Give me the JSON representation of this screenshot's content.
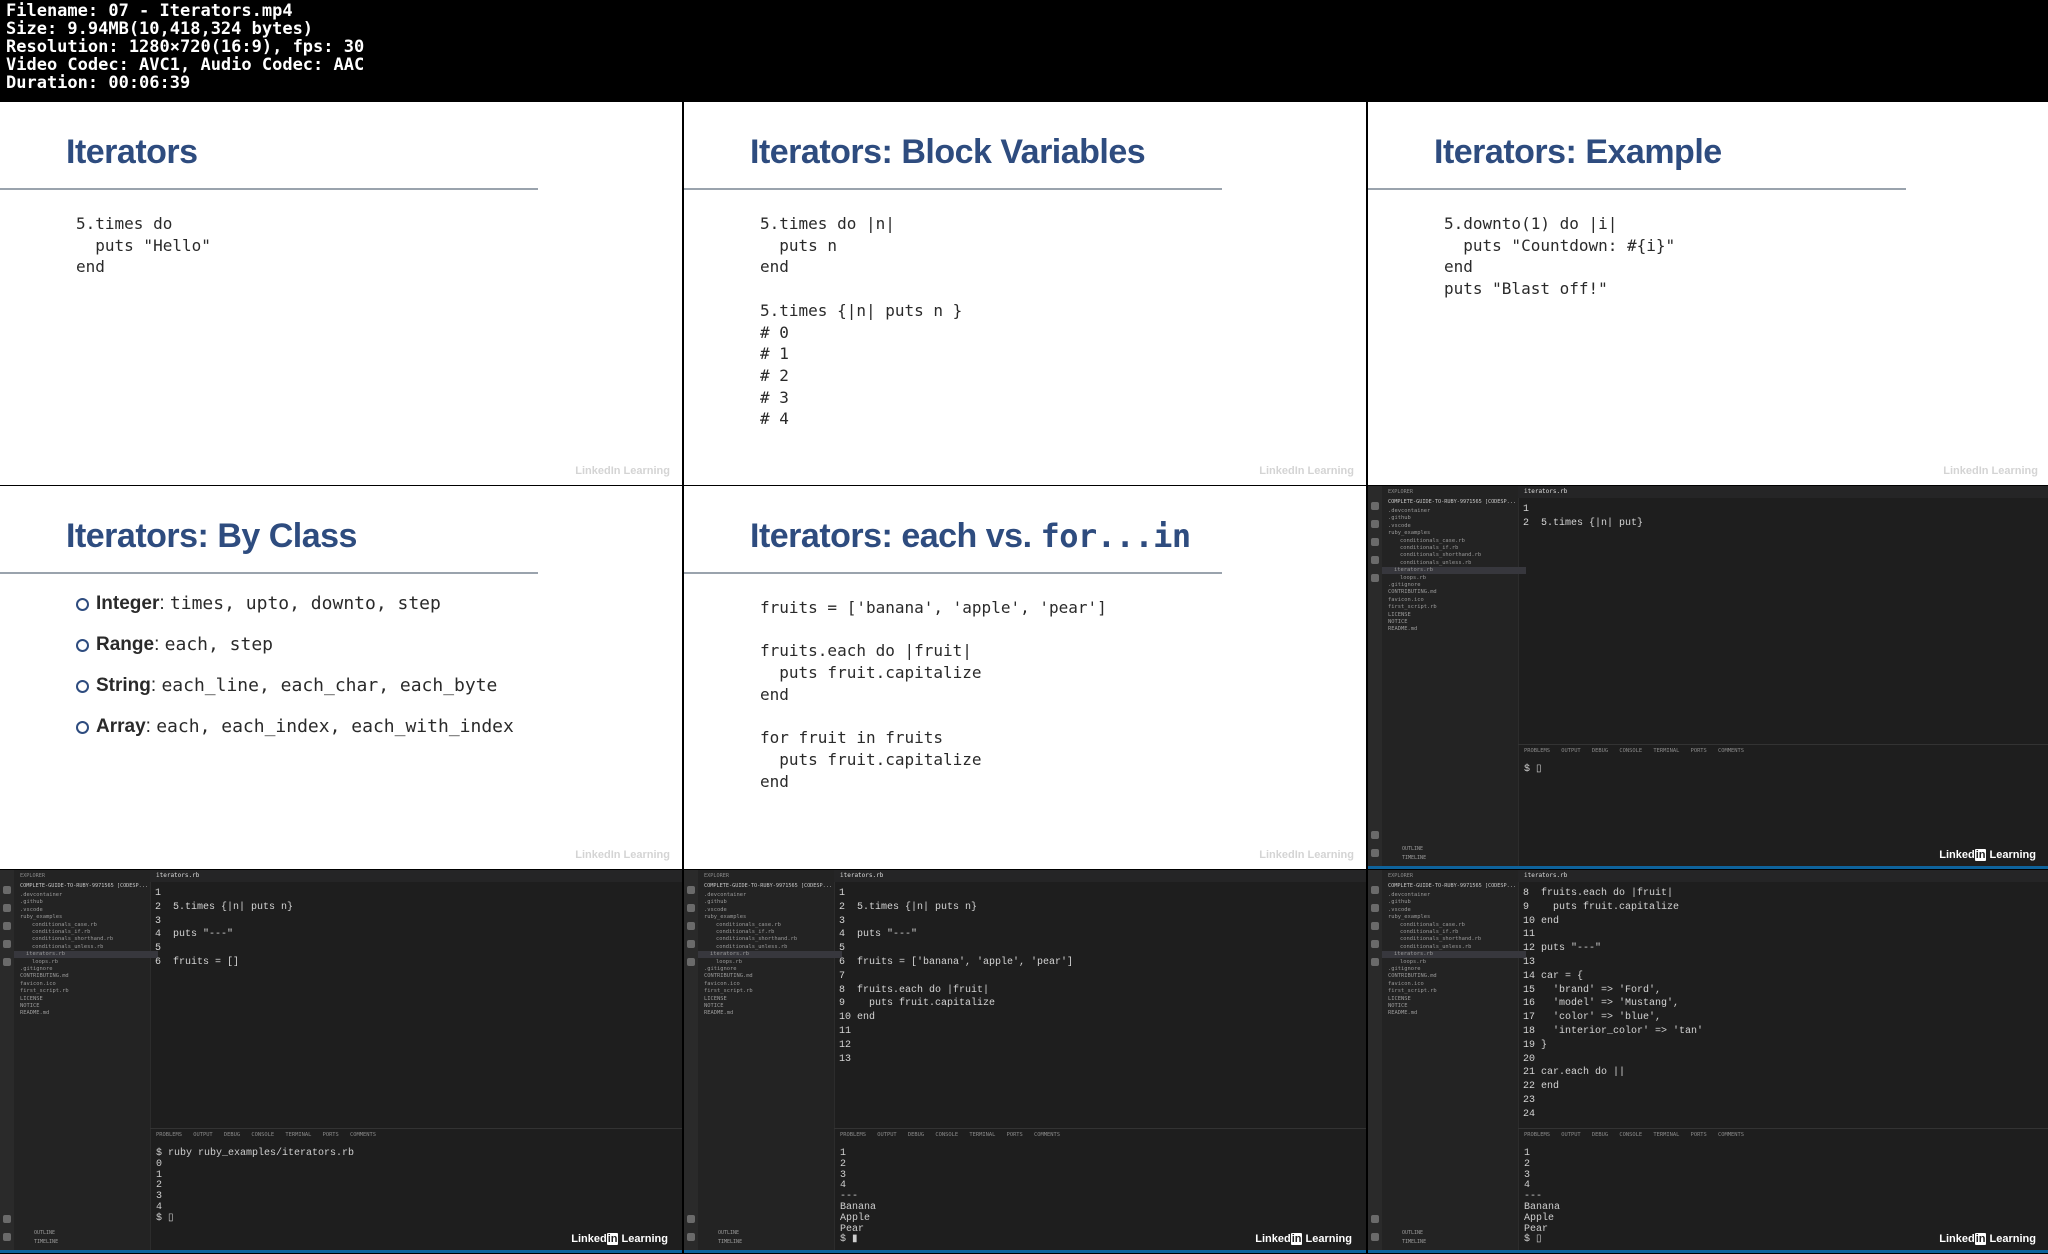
{
  "header": {
    "lines": [
      "Filename: 07 - Iterators.mp4",
      "Size: 9.94MB(10,418,324 bytes)",
      "Resolution: 1280×720(16:9), fps: 30",
      "Video Codec: AVC1, Audio Codec: AAC",
      "Duration: 00:06:39"
    ]
  },
  "watermark": "LinkedIn Learning",
  "watermark_parts": {
    "a": "Linked",
    "b": "in",
    "c": " Learning"
  },
  "slides": {
    "s1": {
      "title": "Iterators",
      "code": [
        "5.times do",
        "  puts \"Hello\"",
        "end"
      ]
    },
    "s2": {
      "title": "Iterators: Block Variables",
      "code": [
        "5.times do |n|",
        "  puts n",
        "end",
        "",
        "5.times {|n| puts n }",
        "# 0",
        "# 1",
        "# 2",
        "# 3",
        "# 4"
      ]
    },
    "s3": {
      "title": "Iterators: Example",
      "code": [
        "5.downto(1) do |i|",
        "  puts \"Countdown: #{i}\"",
        "end",
        "puts \"Blast off!\""
      ]
    },
    "s4": {
      "title": "Iterators: By Class",
      "bullets": [
        {
          "label": "Integer",
          "items": "times, upto, downto, step"
        },
        {
          "label": "Range",
          "items": "each, step"
        },
        {
          "label": "String",
          "items": "each_line, each_char, each_byte"
        },
        {
          "label": "Array",
          "items": "each, each_index, each_with_index"
        }
      ]
    },
    "s5": {
      "title_a": "Iterators: each vs. ",
      "title_b": "for...in",
      "code": [
        "fruits = ['banana', 'apple', 'pear']",
        "",
        "fruits.each do |fruit|",
        "  puts fruit.capitalize",
        "end",
        "",
        "for fruit in fruits",
        "  puts fruit.capitalize",
        "end"
      ]
    }
  },
  "editor": {
    "explorer_label": "EXPLORER",
    "project": "COMPLETE-GUIDE-TO-RUBY-9971565 [CODESP...",
    "files": [
      ".devcontainer",
      ".github",
      ".vscode",
      "ruby_examples",
      "conditionals_case.rb",
      "conditionals_if.rb",
      "conditionals_shorthand.rb",
      "conditionals_unless.rb",
      "iterators.rb",
      "loops.rb",
      ".gitignore",
      "CONTRIBUTING.md",
      "favicon.ico",
      "first_script.rb",
      "LICENSE",
      "NOTICE",
      "README.md"
    ],
    "tab": "iterators.rb",
    "panel_tabs": "PROBLEMS OUTPUT DEBUG CONSOLE TERMINAL PORTS COMMENTS",
    "outline": "OUTLINE",
    "timeline": "TIMELINE"
  },
  "editors": {
    "e1": {
      "code": [
        "1",
        "2  5.times {|n| put}"
      ],
      "term": "$ ▯"
    },
    "e2": {
      "code": [
        "1",
        "2  5.times {|n| puts n}",
        "3",
        "4  puts \"---\"",
        "5",
        "6  fruits = []"
      ],
      "term": "$ ruby ruby_examples/iterators.rb\n0\n1\n2\n3\n4\n$ ▯"
    },
    "e3": {
      "code": [
        "1",
        "2  5.times {|n| puts n}",
        "3",
        "4  puts \"---\"",
        "5",
        "6  fruits = ['banana', 'apple', 'pear']",
        "7",
        "8  fruits.each do |fruit|",
        "9    puts fruit.capitalize",
        "10 end",
        "11",
        "12",
        "13"
      ],
      "term": "1\n2\n3\n4\n---\nBanana\nApple\nPear\n$ ▮"
    },
    "e4": {
      "code": [
        "8  fruits.each do |fruit|",
        "9    puts fruit.capitalize",
        "10 end",
        "11",
        "12 puts \"---\"",
        "13",
        "14 car = {",
        "15   'brand' => 'Ford',",
        "16   'model' => 'Mustang',",
        "17   'color' => 'blue',",
        "18   'interior_color' => 'tan'",
        "19 }",
        "20",
        "21 car.each do ||",
        "22 end",
        "23",
        "24"
      ],
      "term": "1\n2\n3\n4\n---\nBanana\nApple\nPear\n$ ▯"
    }
  }
}
